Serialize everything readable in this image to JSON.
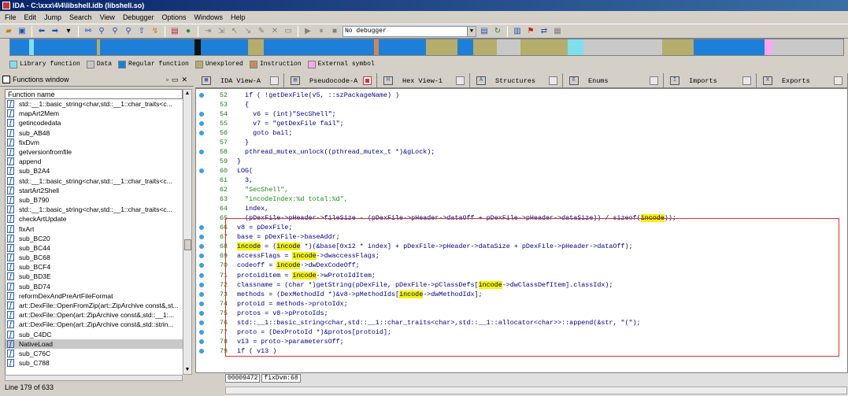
{
  "window": {
    "title": "IDA - C:\\xxx\\4\\4\\libshell.idb (libshell.so)"
  },
  "menu": [
    "File",
    "Edit",
    "Jump",
    "Search",
    "View",
    "Debugger",
    "Options",
    "Windows",
    "Help"
  ],
  "toolbar": {
    "debugger_select": "No debugger"
  },
  "legend": [
    {
      "label": "Library function",
      "color": "#7fdfef"
    },
    {
      "label": "Data",
      "color": "#c8c8c8"
    },
    {
      "label": "Regular function",
      "color": "#1e7fd8"
    },
    {
      "label": "Unexplored",
      "color": "#b5ad6b"
    },
    {
      "label": "Instruction",
      "color": "#c88a5a"
    },
    {
      "label": "External symbol",
      "color": "#f7a8f0"
    }
  ],
  "functions_window": {
    "title": "Functions window",
    "column": "Function name",
    "items": [
      "std::__1::basic_string<char,std::__1::char_traits<c...",
      "mapArt2Mem",
      "getincodedata",
      "sub_AB48",
      "fixDvm",
      "getversionfromfile",
      "append",
      "sub_B2A4",
      "std::__1::basic_string<char,std::__1::char_traits<c...",
      "startArt2Shell",
      "sub_B790",
      "std::__1::basic_string<char,std::__1::char_traits<c...",
      "checkArtUpdate",
      "fixArt",
      "sub_BC20",
      "sub_BC44",
      "sub_BC68",
      "sub_BCF4",
      "sub_BD3E",
      "sub_BD74",
      "reformDexAndPreArtFileFormat",
      "art::DexFile::OpenFromZip(art::ZipArchive const&,st...",
      "art::DexFile::Open(art::ZipArchive const&,std::__1:...",
      "art::DexFile::Open(art::ZipArchive const&,std::strin...",
      "sub_C4DC",
      "NativeLoad",
      "sub_C76C",
      "sub_C788"
    ],
    "selected_index": 25,
    "status": "Line 179 of 633"
  },
  "tabs": [
    {
      "label": "IDA View-A",
      "icon": "▦"
    },
    {
      "label": "Pseudocode-A",
      "icon": "▤",
      "active": true
    },
    {
      "label": "Hex View-1",
      "icon": "H"
    },
    {
      "label": "Structures",
      "icon": "A"
    },
    {
      "label": "Enums",
      "icon": "E"
    },
    {
      "label": "Imports",
      "icon": "I"
    },
    {
      "label": "Exports",
      "icon": "X"
    }
  ],
  "code": [
    {
      "n": "52",
      "dot": true,
      "t": "  if ( !getDexFile(v5, ::szPackageName) )"
    },
    {
      "n": "53",
      "dot": false,
      "t": "  {"
    },
    {
      "n": "54",
      "dot": true,
      "t": "    v6 = (int)\"SecShell\";"
    },
    {
      "n": "55",
      "dot": true,
      "t": "    v7 = \"getDexFile fail\";"
    },
    {
      "n": "56",
      "dot": true,
      "t": "    goto bail;"
    },
    {
      "n": "57",
      "dot": false,
      "t": "  }"
    },
    {
      "n": "58",
      "dot": true,
      "t": "  pthread_mutex_unlock((pthread_mutex_t *)&gLock);"
    },
    {
      "n": "59",
      "dot": false,
      "t": "}"
    },
    {
      "n": "60",
      "dot": true,
      "t": "LOG("
    },
    {
      "n": "61",
      "dot": false,
      "t": "  3,"
    },
    {
      "n": "62",
      "dot": false,
      "t": "  \"SecShell\","
    },
    {
      "n": "63",
      "dot": false,
      "t": "  \"incodeIndex:%d total:%d\","
    },
    {
      "n": "64",
      "dot": false,
      "t": "  index,"
    },
    {
      "n": "65",
      "dot": false,
      "t": "  (pDexFile->pHeader->fileSize - (pDexFile->pHeader->dataOff + pDexFile->pHeader->dataSize)) / sizeof(incode));"
    },
    {
      "n": "66",
      "dot": true,
      "t": "v8 = pDexFile;"
    },
    {
      "n": "67",
      "dot": true,
      "t": "base = pDexFile->baseAddr;"
    },
    {
      "n": "68",
      "dot": true,
      "t": "incode = (incode *)(&base[0x12 * index] + pDexFile->pHeader->dataSize + pDexFile->pHeader->dataOff);"
    },
    {
      "n": "69",
      "dot": true,
      "t": "accessFlags = incode->dwaccessFlags;"
    },
    {
      "n": "70",
      "dot": true,
      "t": "codeoff = incode->dwDexCodeOff;"
    },
    {
      "n": "71",
      "dot": true,
      "t": "protoiditem = incode->wProtoIdItem;"
    },
    {
      "n": "72",
      "dot": true,
      "t": "classname = (char *)getString(pDexFile, pDexFile->pClassDefs[incode->dwClassDefItem].classIdx);"
    },
    {
      "n": "73",
      "dot": true,
      "t": "methods = (DexMethodId *)&v8->pMethodIds[incode->dwMethodIdx];"
    },
    {
      "n": "74",
      "dot": true,
      "t": "protoid = methods->protoIdx;"
    },
    {
      "n": "75",
      "dot": true,
      "t": "protos = v8->pProtoIds;"
    },
    {
      "n": "76",
      "dot": true,
      "t": "std::__1::basic_string<char,std::__1::char_traits<char>,std::__1::allocator<char>>::append(&str, \"(\");"
    },
    {
      "n": "77",
      "dot": true,
      "t": "proto = (DexProtoId *)&protos[protoid];"
    },
    {
      "n": "78",
      "dot": true,
      "t": "v13 = proto->parametersOff;"
    },
    {
      "n": "79",
      "dot": true,
      "t": "if ( v13 )"
    }
  ],
  "highlight_word": "incode",
  "statusbar": {
    "addr": "00009472",
    "func": "fixDvm:68"
  }
}
